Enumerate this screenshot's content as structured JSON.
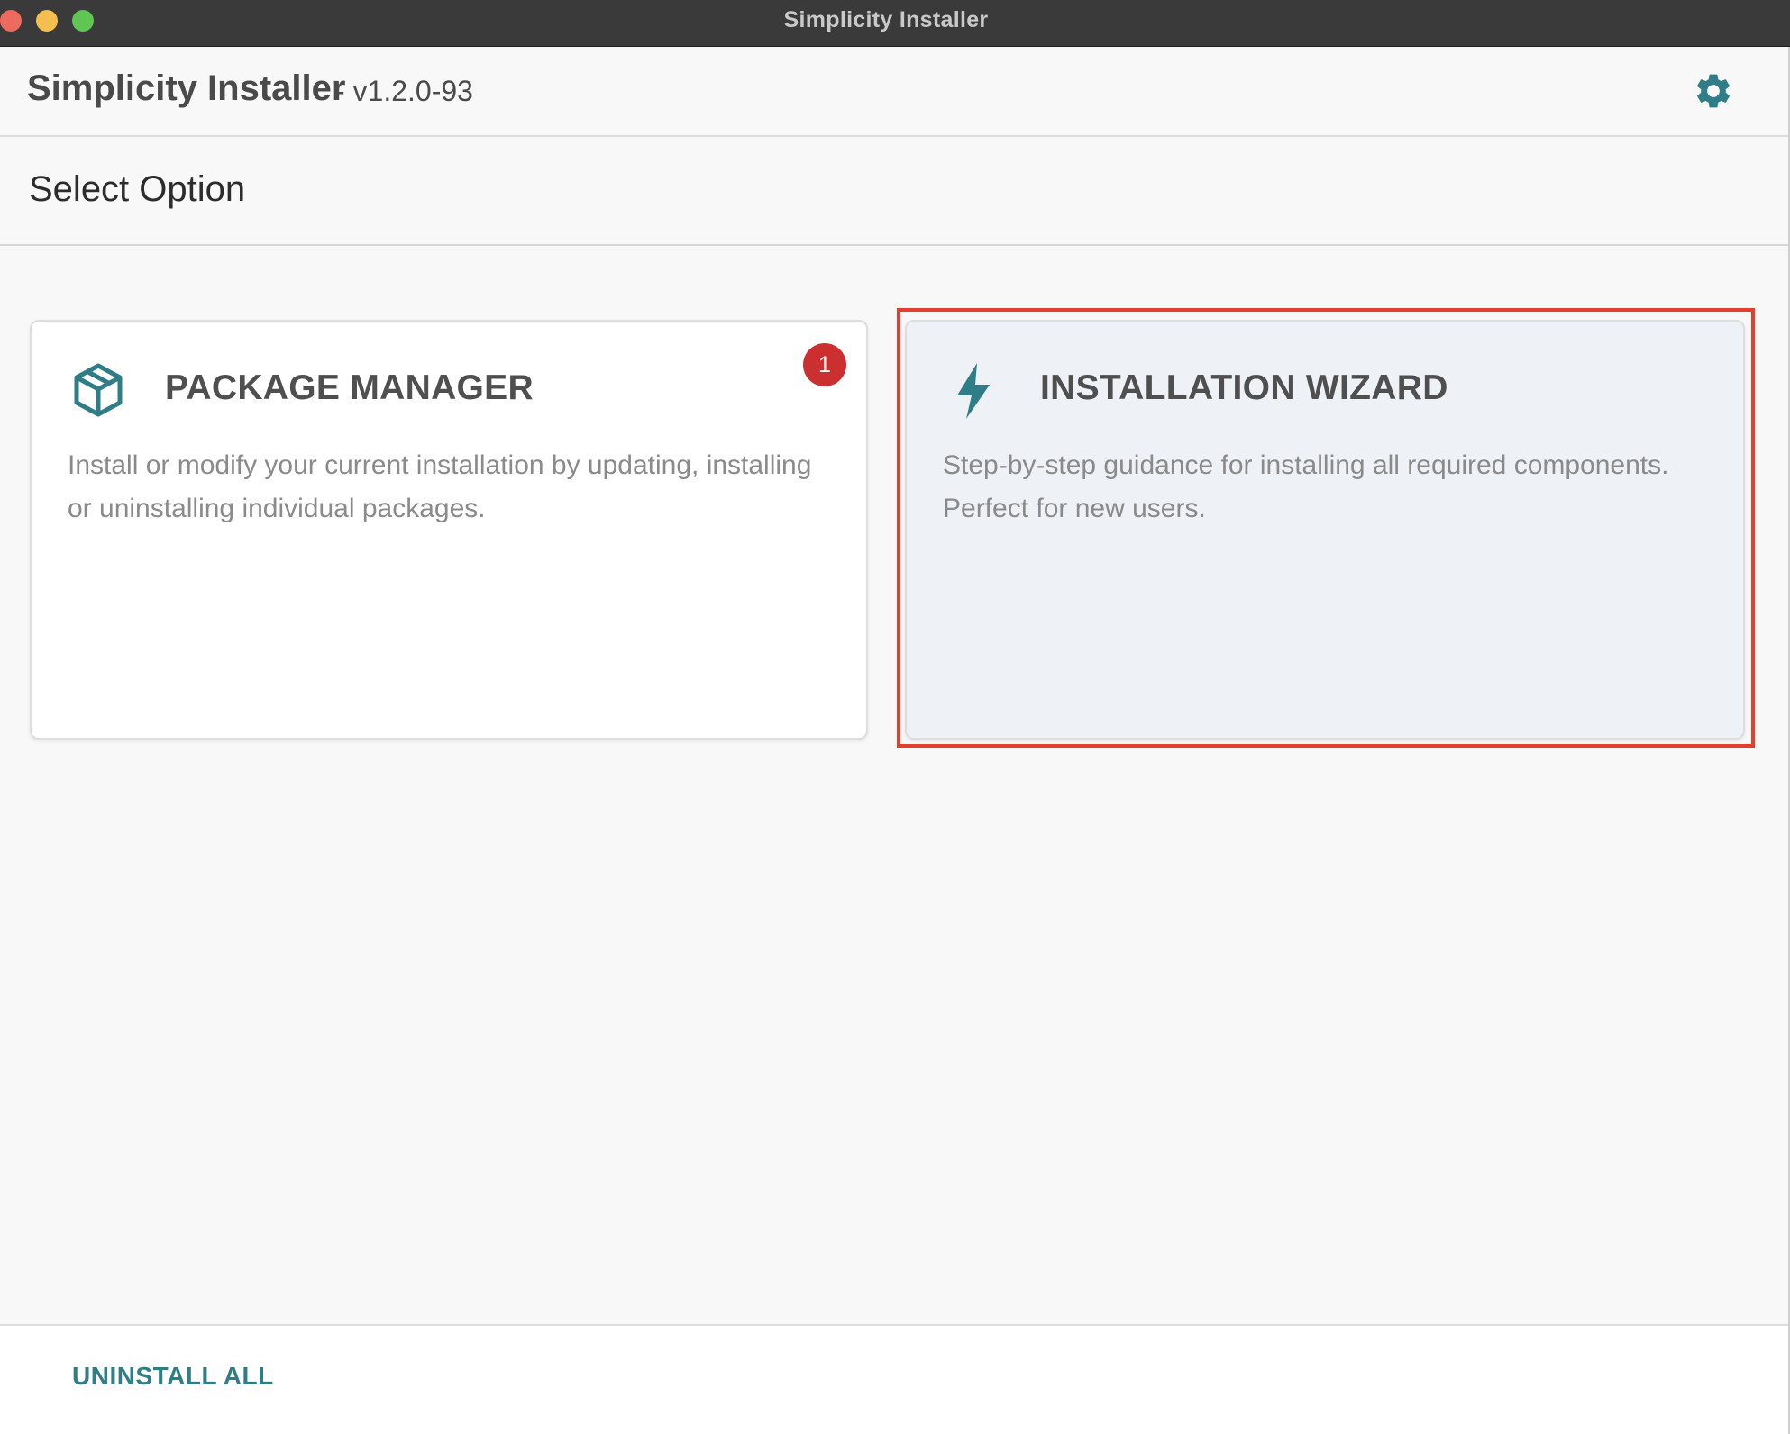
{
  "window": {
    "title": "Simplicity Installer"
  },
  "header": {
    "app_name": "Simplicity Installer",
    "version": "- v1.2.0-93",
    "settings_icon": "gear-icon"
  },
  "page": {
    "section_title": "Select Option"
  },
  "cards": [
    {
      "icon": "package-box-icon",
      "title": "PACKAGE MANAGER",
      "description": "Install or modify your current installation by updating, installing or uninstalling individual packages.",
      "badge": "1"
    },
    {
      "icon": "lightning-bolt-icon",
      "title": "INSTALLATION WIZARD",
      "description": "Step-by-step guidance for installing all required components. Perfect for new users."
    }
  ],
  "footer": {
    "uninstall_label": "UNINSTALL ALL"
  },
  "colors": {
    "accent": "#2f7d86",
    "badge": "#cc2f2f",
    "highlight": "#e2402e"
  }
}
